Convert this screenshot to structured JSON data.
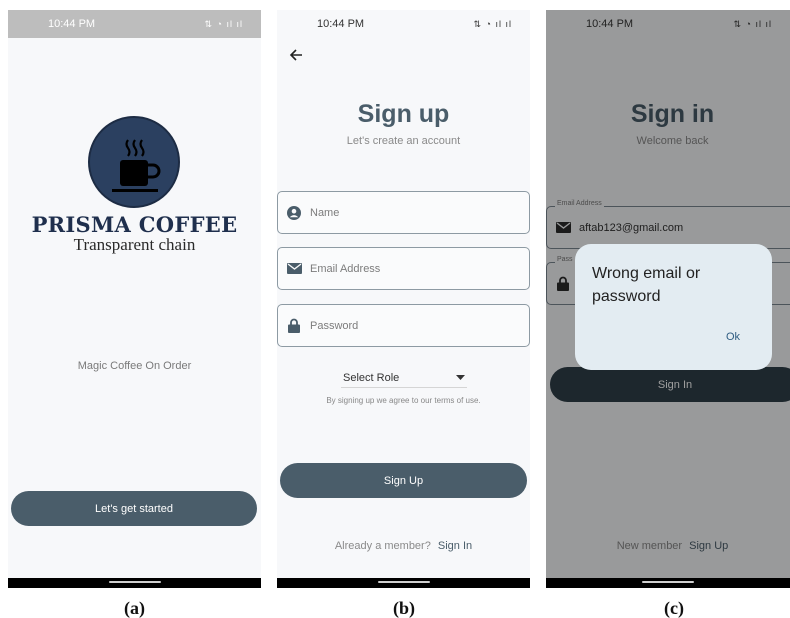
{
  "panel_a": {
    "status_time": "10:44 PM",
    "status_icons": "⇅ ◔ ıl ıl",
    "brand_title": "PRISMA COFFEE",
    "brand_subtitle": "Transparent chain",
    "tagline": "Magic Coffee On Order",
    "cta_label": "Let's get started",
    "caption": "(a)"
  },
  "panel_b": {
    "status_time": "10:44 PM",
    "status_icons": "⇅ ◔ ıl ıl",
    "title": "Sign up",
    "subtitle": "Let's create an account",
    "name_placeholder": "Name",
    "email_placeholder": "Email Address",
    "password_placeholder": "Password",
    "role_label": "Select Role",
    "terms": "By signing up we agree to our terms of use.",
    "submit_label": "Sign Up",
    "footer_text": "Already a member?",
    "footer_link": "Sign In",
    "caption": "(b)"
  },
  "panel_c": {
    "status_time": "10:44 PM",
    "status_icons": "⇅ ◔ ıl ıl",
    "title": "Sign in",
    "subtitle": "Welcome back",
    "email_legend": "Email Address",
    "email_value": "aftab123@gmail.com",
    "password_legend": "Pass",
    "submit_label": "Sign In",
    "footer_text": "New member",
    "footer_link": "Sign Up",
    "dialog_message": "Wrong email or password",
    "dialog_ok": "Ok",
    "caption": "(c)"
  },
  "colors": {
    "accent": "#4a5d6a",
    "brand_navy": "#2b4060",
    "dialog_bg": "#e3ecf2"
  }
}
